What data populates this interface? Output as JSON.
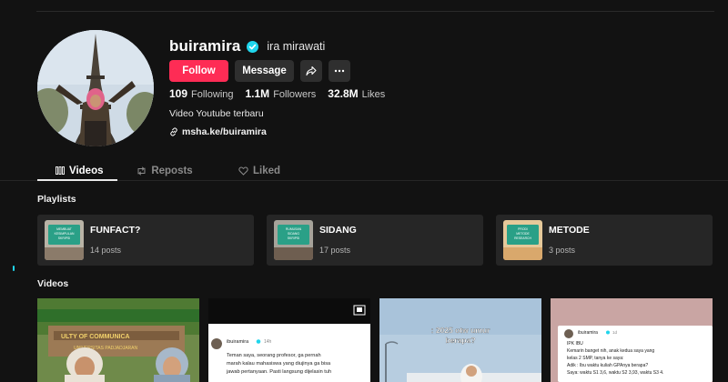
{
  "profile": {
    "username": "buiramira",
    "display_name": "ira mirawati",
    "bio": "Video Youtube terbaru",
    "link": "msha.ke/buiramira",
    "verified_color": "#20d5ec"
  },
  "actions": {
    "follow_label": "Follow",
    "message_label": "Message",
    "share_icon": "share-arrow-icon",
    "more_icon": "more-dots-icon"
  },
  "stats": [
    {
      "value": "109",
      "label": "Following"
    },
    {
      "value": "1.1M",
      "label": "Followers"
    },
    {
      "value": "32.8M",
      "label": "Likes"
    }
  ],
  "tabs": [
    {
      "label": "Videos",
      "icon": "grid-icon",
      "active": true
    },
    {
      "label": "Reposts",
      "icon": "repost-icon",
      "active": false
    },
    {
      "label": "Liked",
      "icon": "liked-icon",
      "active": false
    }
  ],
  "sections": {
    "playlists_title": "Playlists",
    "videos_title": "Videos"
  },
  "playlists": [
    {
      "name": "FUNFACT?",
      "posts": "14 posts",
      "thumb_lines": [
        "MEMBUAT",
        "KESIMPULAN",
        "SKRIPSI"
      ]
    },
    {
      "name": "SIDANG",
      "posts": "17 posts",
      "thumb_lines": [
        "RUMUSAN",
        "SIDANG",
        "SKRIPSI"
      ]
    },
    {
      "name": "METODE",
      "posts": "3 posts",
      "thumb_lines": [
        "PRODI",
        "METODE",
        "RESEARCH"
      ]
    }
  ],
  "videos": [
    {
      "caption_lines": [
        "ULTY OF COMMUNICA",
        "UNIVERSITAS PADJADJARAN"
      ]
    },
    {
      "author": "ibuiramira",
      "time": "14h",
      "lines": [
        "Teman saya, seorang profesor, ga pernah",
        "marah kalau mahasiswa yang diujinya ga bisa",
        "jawab pertanyaan. Pasti langsung dijelasin tuh"
      ]
    },
    {
      "overlay_lines": [
        ": 2025 otw umur",
        "berapa?"
      ]
    },
    {
      "author": "ibuiramira",
      "time": "1d",
      "lines": [
        "IPK IBU",
        "Kemarin banget nih, anak kedua saya yang",
        "kelas 2 SMP, tanya ke saya:",
        "Adik : Ibu waktu kuliah GPAnya berapa?",
        "Saya: waktu S1 3,6, waktu S2 3,93, waktu S3 4."
      ]
    }
  ],
  "colors": {
    "accent": "#fe2c55",
    "background": "#121212",
    "card": "#262626",
    "button": "#2f2f2f"
  }
}
